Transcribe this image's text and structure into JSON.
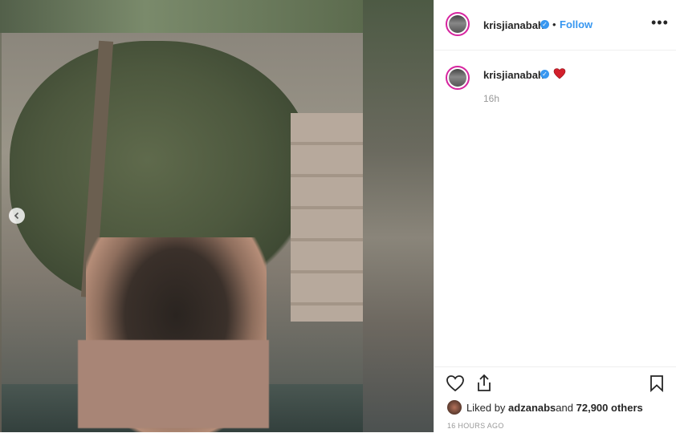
{
  "post": {
    "username": "krisjianabah",
    "follow_label": "Follow",
    "separator": "•",
    "more_label": "•••"
  },
  "caption": {
    "username": "krisjianabah",
    "time": "16h"
  },
  "likes": {
    "prefix": "Liked by ",
    "user": "adzanabs",
    "middle": " and ",
    "count": "72,900 others"
  },
  "posted_time": "16 HOURS AGO",
  "colors": {
    "accent": "#3897f0",
    "ring": "#d6249f",
    "heart": "#e0245e"
  },
  "icons": {
    "carousel_prev": "chevron-left-icon",
    "verified": "verified-badge-icon",
    "like": "heart-outline-icon",
    "share": "share-icon",
    "save": "bookmark-icon",
    "caption_emoji": "red-heart-emoji"
  }
}
